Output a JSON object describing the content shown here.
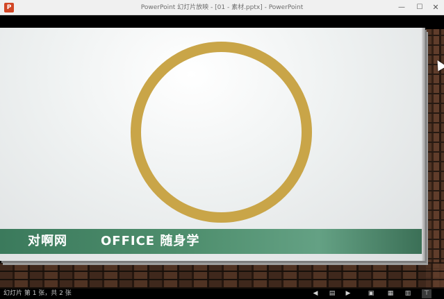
{
  "window": {
    "app_icon_letter": "P",
    "title": "PowerPoint 幻灯片放映 - [01 - 素材.pptx] - PowerPoint",
    "controls": {
      "minimize": "—",
      "maximize": "☐",
      "close": "✕"
    }
  },
  "slide": {
    "ring_color": "#c9a548",
    "banner_color": "#4f8f6e",
    "brand": "对啊网",
    "slogan": "OFFICE 随身学"
  },
  "statusbar": {
    "slide_counter": "幻灯片 第 1 张，共 2 张",
    "icons": {
      "prev": "◀",
      "menu": "▤",
      "next": "▶",
      "normal": "▣",
      "sorter": "▦",
      "reading": "▥",
      "slideshow": "⊤"
    }
  }
}
